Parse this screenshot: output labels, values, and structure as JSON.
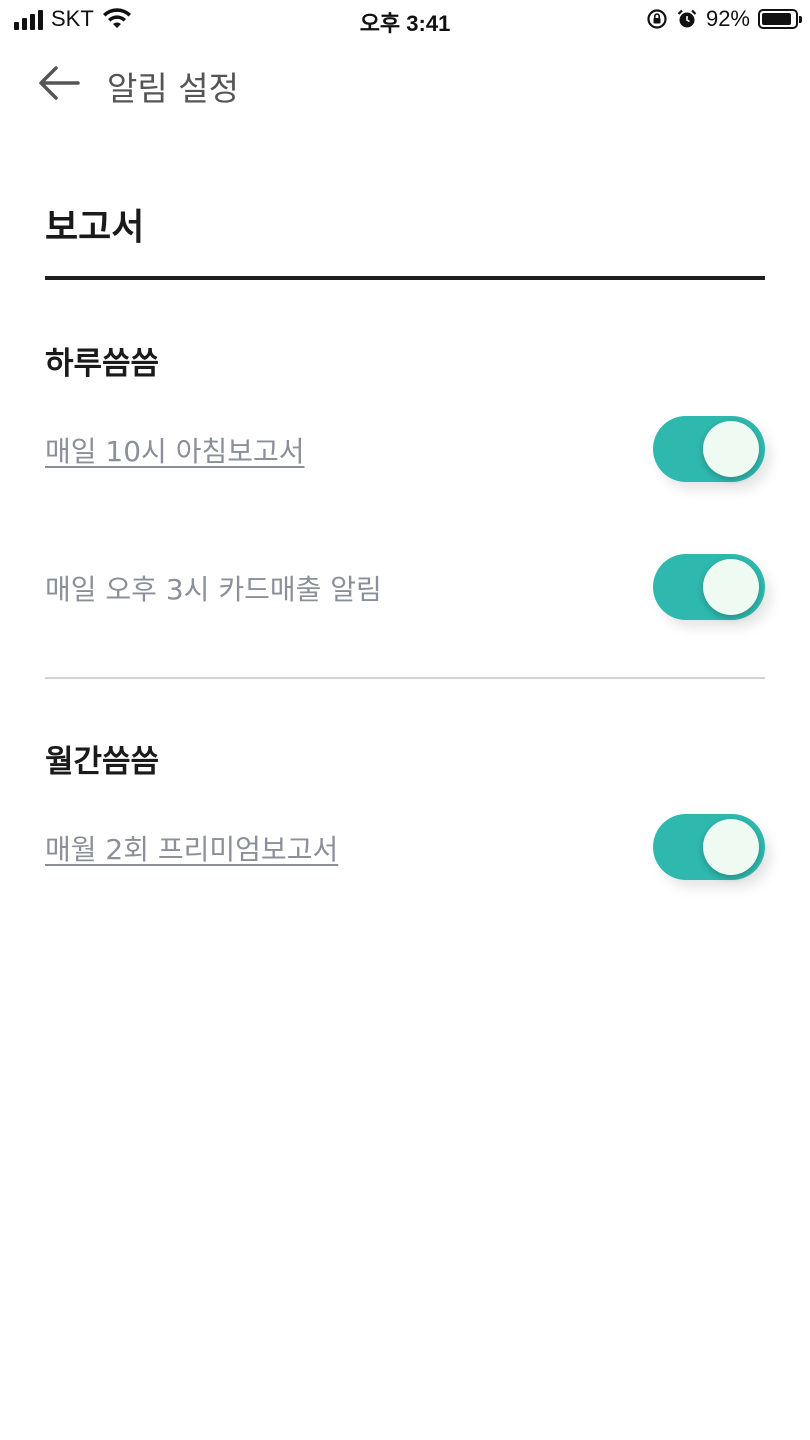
{
  "status_bar": {
    "carrier": "SKT",
    "time": "오후 3:41",
    "battery_pct": "92%",
    "battery_level": 0.92,
    "icons": [
      "signal-icon",
      "wifi-icon",
      "rotation-lock-icon",
      "alarm-icon",
      "battery-icon"
    ]
  },
  "header": {
    "back_icon": "arrow-left-icon",
    "title": "알림 설정"
  },
  "section": {
    "title": "보고서"
  },
  "groups": [
    {
      "title": "하루씀씀",
      "items": [
        {
          "label": "매일 10시 아침보고서",
          "underlined": true,
          "enabled": true
        },
        {
          "label": "매일 오후 3시 카드매출 알림",
          "underlined": false,
          "enabled": true
        }
      ]
    },
    {
      "title": "월간씀씀",
      "items": [
        {
          "label": "매월 2회 프리미엄보고서",
          "underlined": true,
          "enabled": true
        }
      ]
    }
  ],
  "colors": {
    "toggle_on": "#2eb8ae",
    "knob": "#effbf2",
    "label_gray": "#8a8f99"
  }
}
